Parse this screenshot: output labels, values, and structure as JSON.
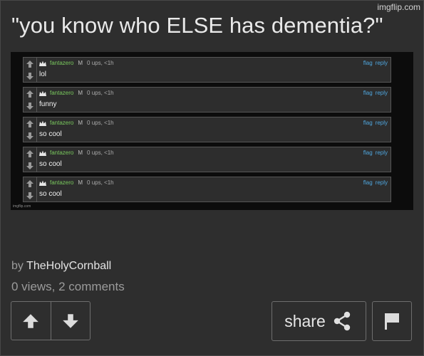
{
  "watermark": "imgflip.com",
  "title": "\"you know who ELSE has dementia?\"",
  "meme": {
    "comments": [
      {
        "user": "fantazero",
        "mod": "M",
        "meta": "0 ups, <1h",
        "flag": "flag",
        "reply": "reply",
        "text": "lol"
      },
      {
        "user": "fantazero",
        "mod": "M",
        "meta": "0 ups, <1h",
        "flag": "flag",
        "reply": "reply",
        "text": "funny"
      },
      {
        "user": "fantazero",
        "mod": "M",
        "meta": "0 ups, <1h",
        "flag": "flag",
        "reply": "reply",
        "text": "so cool"
      },
      {
        "user": "fantazero",
        "mod": "M",
        "meta": "0 ups, <1h",
        "flag": "flag",
        "reply": "reply",
        "text": "so cool"
      },
      {
        "user": "fantazero",
        "mod": "M",
        "meta": "0 ups, <1h",
        "flag": "flag",
        "reply": "reply",
        "text": "so cool"
      }
    ],
    "small_watermark": "imgflip.com"
  },
  "byline": {
    "prefix": "by",
    "author": "TheHolyCornball"
  },
  "stats": "0 views, 2 comments",
  "buttons": {
    "share": "share"
  },
  "icons": {
    "upvote": "arrow-up-icon",
    "downvote": "arrow-down-icon",
    "share": "share-icon",
    "flag": "flag-icon",
    "crown": "crown-icon"
  }
}
